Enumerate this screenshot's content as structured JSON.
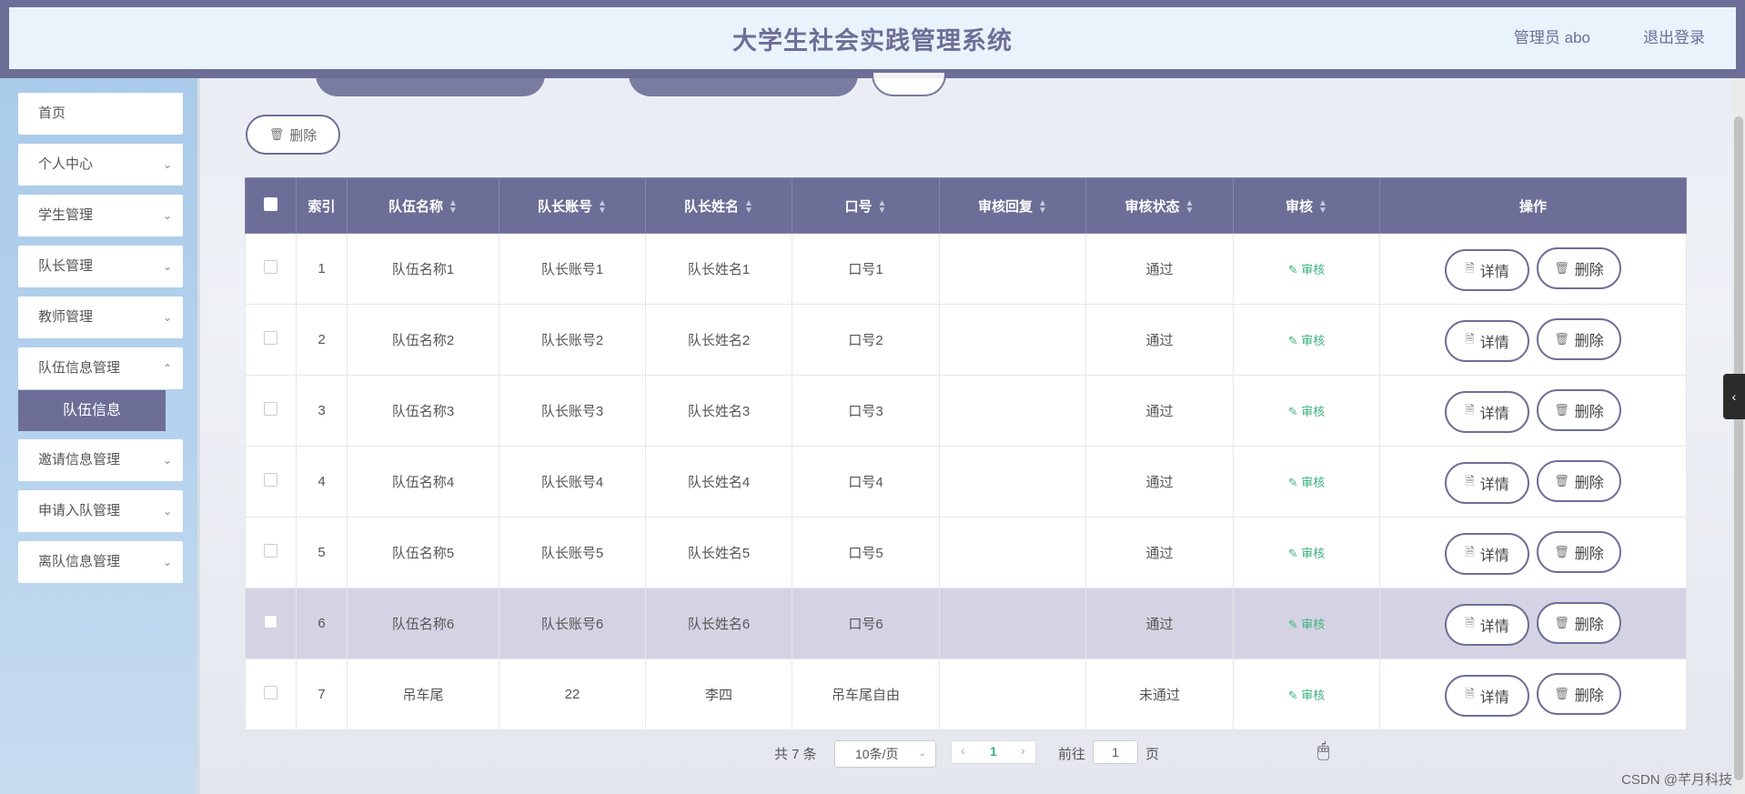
{
  "header": {
    "title": "大学生社会实践管理系统",
    "user": "管理员 abo",
    "logout": "退出登录"
  },
  "sidebar": {
    "items": [
      {
        "label": "首页"
      },
      {
        "label": "个人中心"
      },
      {
        "label": "学生管理"
      },
      {
        "label": "队长管理"
      },
      {
        "label": "教师管理"
      },
      {
        "label": "队伍信息管理"
      },
      {
        "label": "邀请信息管理"
      },
      {
        "label": "申请入队管理"
      },
      {
        "label": "离队信息管理"
      }
    ],
    "active_sub": "队伍信息"
  },
  "toolbar": {
    "delete_label": "删除"
  },
  "table": {
    "headers": [
      "索引",
      "队伍名称",
      "队长账号",
      "队长姓名",
      "口号",
      "审核回复",
      "审核状态",
      "审核",
      "操作"
    ],
    "audit_label": "审核",
    "detail_label": "详情",
    "delete_label": "删除",
    "rows": [
      {
        "idx": "1",
        "team": "队伍名称1",
        "account": "队长账号1",
        "name": "队长姓名1",
        "slogan": "口号1",
        "reply": "",
        "status": "通过"
      },
      {
        "idx": "2",
        "team": "队伍名称2",
        "account": "队长账号2",
        "name": "队长姓名2",
        "slogan": "口号2",
        "reply": "",
        "status": "通过"
      },
      {
        "idx": "3",
        "team": "队伍名称3",
        "account": "队长账号3",
        "name": "队长姓名3",
        "slogan": "口号3",
        "reply": "",
        "status": "通过"
      },
      {
        "idx": "4",
        "team": "队伍名称4",
        "account": "队长账号4",
        "name": "队长姓名4",
        "slogan": "口号4",
        "reply": "",
        "status": "通过"
      },
      {
        "idx": "5",
        "team": "队伍名称5",
        "account": "队长账号5",
        "name": "队长姓名5",
        "slogan": "口号5",
        "reply": "",
        "status": "通过"
      },
      {
        "idx": "6",
        "team": "队伍名称6",
        "account": "队长账号6",
        "name": "队长姓名6",
        "slogan": "口号6",
        "reply": "",
        "status": "通过"
      },
      {
        "idx": "7",
        "team": "吊车尾",
        "account": "22",
        "name": "李四",
        "slogan": "吊车尾自由",
        "reply": "",
        "status": "未通过"
      }
    ]
  },
  "pager": {
    "total": "共 7 条",
    "page_size": "10条/页",
    "current": "1",
    "goto_label": "前往",
    "goto_value": "1",
    "page_unit": "页"
  },
  "watermark": "CSDN @芊月科技",
  "colors": {
    "primary": "#6d6e97",
    "success": "#3cb37e",
    "sidebar": "#b5d2ee"
  }
}
